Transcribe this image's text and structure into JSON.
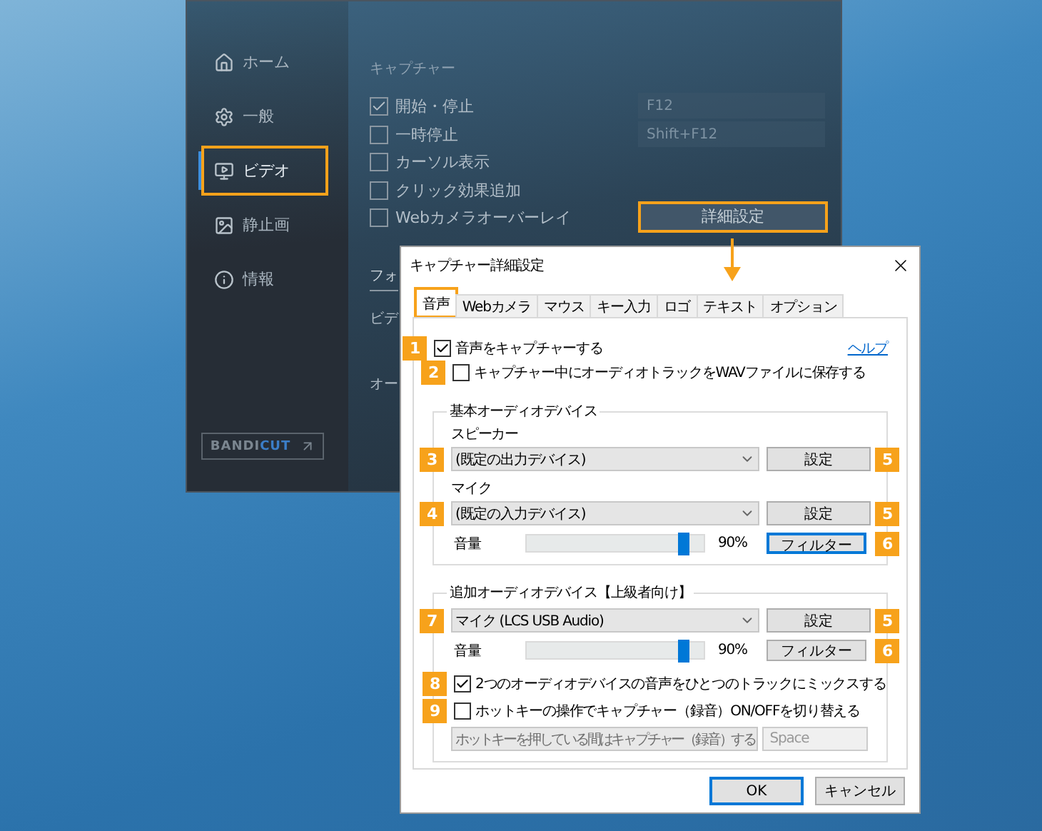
{
  "app": {
    "sidebar": [
      {
        "label": "ホーム",
        "selected": false,
        "highlighted": false
      },
      {
        "label": "一般",
        "selected": false,
        "highlighted": false
      },
      {
        "label": "ビデオ",
        "selected": true,
        "highlighted": true
      },
      {
        "label": "静止画",
        "selected": false,
        "highlighted": false
      },
      {
        "label": "情報",
        "selected": false,
        "highlighted": false
      }
    ],
    "logo": {
      "text": "BANDI",
      "accent": "CUT"
    },
    "capture": {
      "title": "キャプチャー",
      "options": [
        {
          "label": "開始・停止",
          "checked": true
        },
        {
          "label": "一時停止",
          "checked": false
        },
        {
          "label": "カーソル表示",
          "checked": false
        },
        {
          "label": "クリック効果追加",
          "checked": false
        },
        {
          "label": "Webカメラオーバーレイ",
          "checked": false
        }
      ],
      "hotkeys": [
        "F12",
        "Shift+F12"
      ],
      "advanced_button": {
        "label": "詳細設定",
        "highlighted": true
      }
    },
    "format": {
      "title": "フォ",
      "rows": [
        "ビデ",
        "オー"
      ]
    }
  },
  "dialog": {
    "title": "キャプチャー詳細設定",
    "tabs": [
      {
        "label": "音声",
        "selected": true,
        "highlighted": true
      },
      {
        "label": "Webカメラ",
        "selected": false,
        "highlighted": false
      },
      {
        "label": "マウス",
        "selected": false,
        "highlighted": false
      },
      {
        "label": "キー入力",
        "selected": false,
        "highlighted": false
      },
      {
        "label": "ロゴ",
        "selected": false,
        "highlighted": false
      },
      {
        "label": "テキスト",
        "selected": false,
        "highlighted": false
      },
      {
        "label": "オプション",
        "selected": false,
        "highlighted": false
      }
    ],
    "capture_audio": {
      "badge": "1",
      "label": "音声をキャプチャーする",
      "checked": true,
      "children": [
        {
          "badge": "2",
          "label": "キャプチャー中にオーディオトラックをWAVファイルに保存する",
          "checked": false
        }
      ]
    },
    "help_link": "ヘルプ",
    "groups": [
      {
        "title": "基本オーディオデバイス",
        "devices": [
          {
            "label": "スピーカー",
            "badge": "3",
            "device": "(既定の出力デバイス)",
            "settings": {
              "label": "設定",
              "badge": "5"
            }
          },
          {
            "label": "マイク",
            "badge": "4",
            "device": "(既定の入力デバイス)",
            "settings": {
              "label": "設定",
              "badge": "5"
            },
            "volume": {
              "label": "音量",
              "level": 0.9,
              "reading": "90%"
            },
            "filter": {
              "label": "フィルター",
              "badge": "6",
              "focused": true
            }
          }
        ]
      },
      {
        "title": "追加オーディオデバイス【上級者向け】",
        "devices": [
          {
            "badge": "7",
            "device": "マイク (LCS USB Audio)",
            "settings": {
              "label": "設定",
              "badge": "5"
            },
            "volume": {
              "label": "音量",
              "level": 0.9,
              "reading": "90%"
            },
            "filter": {
              "label": "フィルター",
              "badge": "6",
              "focused": false
            }
          }
        ],
        "options": [
          {
            "badge": "8",
            "label": "2つのオーディオデバイスの音声をひとつのトラックにミックスする",
            "checked": true
          },
          {
            "badge": "9",
            "label": "ホットキーの操作でキャプチャー（録音）ON/OFFを切り替える",
            "checked": false
          }
        ],
        "hotkey_mode": {
          "value": "ホットキーを押している間はキャプチャー（録音）する",
          "disabled": true
        },
        "hotkey_key": {
          "value": "Space",
          "disabled": true
        }
      }
    ],
    "buttons": [
      {
        "label": "OK",
        "default": true
      },
      {
        "label": "キャンセル",
        "default": false
      }
    ]
  }
}
